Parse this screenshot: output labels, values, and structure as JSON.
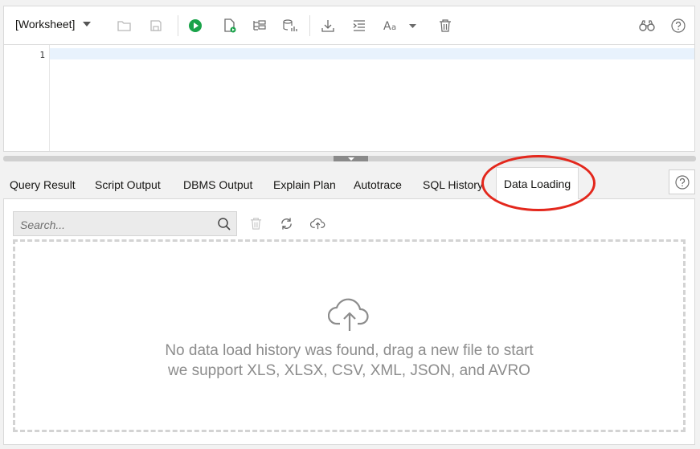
{
  "toolbar": {
    "worksheet_label": "[Worksheet]",
    "colors": {
      "run_green": "#1aa34a",
      "icon_gray": "#6b6b6b",
      "disabled_gray": "#b8b8b8"
    }
  },
  "editor": {
    "line_numbers": [
      "1"
    ]
  },
  "tabs": [
    {
      "label": "Query Result"
    },
    {
      "label": "Script Output"
    },
    {
      "label": "DBMS Output"
    },
    {
      "label": "Explain Plan"
    },
    {
      "label": "Autotrace"
    },
    {
      "label": "SQL History"
    },
    {
      "label": "Data Loading",
      "active": true
    }
  ],
  "data_loading": {
    "search_placeholder": "Search...",
    "message_line1": "No data load history was found, drag a new file to start",
    "message_line2": "we support XLS, XLSX, CSV, XML, JSON, and AVRO"
  },
  "annotation": {
    "color": "#e3271c"
  }
}
